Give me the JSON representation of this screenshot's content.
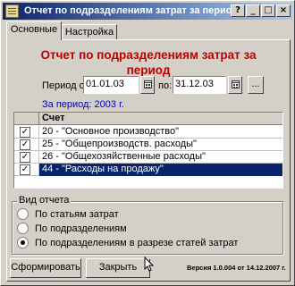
{
  "window": {
    "title": "Отчет по подразделениям затрат за период",
    "title_buttons": {
      "help": "?",
      "minimize": "_",
      "maximize": "□",
      "close": "×"
    }
  },
  "tabs": [
    {
      "label": "Основные",
      "active": true
    },
    {
      "label": "Настройка",
      "active": false
    }
  ],
  "report": {
    "title": "Отчет по подразделениям затрат за период",
    "period_from_label": "Период с:",
    "period_from": "01.01.03",
    "period_to_label": "по:",
    "period_to": "31.12.03",
    "dots": "...",
    "period_info": "За период: 2003 г."
  },
  "grid": {
    "column_header": "Счет",
    "rows": [
      {
        "checked": true,
        "name": "20 - \"Основное производство\"",
        "selected": false
      },
      {
        "checked": true,
        "name": "25 - \"Общепроизводств. расходы\"",
        "selected": false
      },
      {
        "checked": true,
        "name": "26 - \"Общехозяйственные расходы\"",
        "selected": false
      },
      {
        "checked": true,
        "name": "44 - \"Расходы на продажу\"",
        "selected": true
      }
    ]
  },
  "report_type": {
    "label": "Вид отчета",
    "options": [
      {
        "label": "По статьям затрат",
        "selected": false
      },
      {
        "label": "По подразделениям",
        "selected": false
      },
      {
        "label": "По подразделениям в разрезе статей затрат",
        "selected": true
      }
    ]
  },
  "buttons": {
    "generate": "Сформировать",
    "close": "Закрыть"
  },
  "version": "Версия 1.0.004 от 14.12.2007 г."
}
